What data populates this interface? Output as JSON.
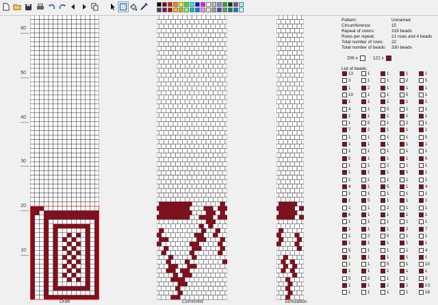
{
  "colors": {
    "filled": "#8b0b1b",
    "empty": "#ffffff",
    "line": "#333333"
  },
  "toolbar": {
    "items": [
      {
        "icon": "new-file-icon"
      },
      {
        "icon": "open-folder-icon"
      },
      {
        "icon": "save-icon"
      },
      {
        "icon": "print-icon"
      },
      {
        "icon": "undo-icon"
      },
      {
        "icon": "redo-icon"
      },
      {
        "icon": "arrow-left-icon"
      },
      {
        "icon": "arrow-right-icon"
      },
      {
        "icon": "copy-icon"
      },
      {
        "icon": "pointer-icon"
      },
      {
        "icon": "rectangle-select-icon"
      },
      {
        "icon": "fill-icon"
      },
      {
        "icon": "pipette-icon"
      }
    ],
    "palette": [
      "#000000",
      "#7f0000",
      "#ff0000",
      "#ff8000",
      "#ffff00",
      "#00ff00",
      "#00ffff",
      "#0000ff",
      "#ff00ff",
      "#ffffff",
      "#c0c0c0",
      "#8080ff",
      "#00c000",
      "#004000",
      "#8040c0",
      "#80ffff",
      "#404040",
      "#800080",
      "#c00000",
      "#ffc000",
      "#c0c000",
      "#80ff80",
      "#00c0c0",
      "#0080ff",
      "#ff80ff",
      "#e0e0e0",
      "#a0a0a0",
      "#4040c0",
      "#60a060",
      "#008080",
      "#0080c0",
      "#c0ffff"
    ]
  },
  "ruler": {
    "ticks": [
      "60",
      "50",
      "40",
      "30",
      "20",
      "10"
    ]
  },
  "panels": {
    "draft": "Draft",
    "corrected": "Corrected",
    "simulation": "Simulation"
  },
  "info": {
    "pattern_label": "Pattern:",
    "pattern_value": "Unnamed",
    "circ_label": "Circumference:",
    "circ_value": "15",
    "repeat_label": "Repeat of colors:",
    "repeat_value": "319 beads",
    "rows_repeat_label": "Rows per repeat:",
    "rows_repeat_value": "21 rows and 4 beads",
    "rows_label": "Total number of rows:",
    "rows_value": "22",
    "beads_label": "Total number of beads:",
    "beads_value": "330 beads",
    "count_white": "208 x",
    "count_red": "122 x",
    "list_title": "List of beads"
  },
  "bead_list": [
    [
      {
        "c": 1,
        "n": "13"
      },
      {
        "c": 0,
        "n": "1"
      },
      {
        "c": 1,
        "n": "1"
      },
      {
        "c": 1,
        "n": "1"
      },
      {
        "c": 1,
        "n": "1"
      }
    ],
    [
      {
        "c": 0,
        "n": "3"
      },
      {
        "c": 0,
        "n": "1"
      },
      {
        "c": 0,
        "n": "1"
      },
      {
        "c": 0,
        "n": "2"
      },
      {
        "c": 0,
        "n": "5"
      }
    ],
    [
      {
        "c": 1,
        "n": "1"
      },
      {
        "c": 1,
        "n": "2"
      },
      {
        "c": 1,
        "n": "1"
      },
      {
        "c": 1,
        "n": "1"
      },
      {
        "c": 1,
        "n": "1"
      }
    ],
    [
      {
        "c": 0,
        "n": "10"
      },
      {
        "c": 0,
        "n": "1"
      },
      {
        "c": 0,
        "n": "1"
      },
      {
        "c": 0,
        "n": "5"
      },
      {
        "c": 0,
        "n": "1"
      }
    ],
    [
      {
        "c": 1,
        "n": "1"
      },
      {
        "c": 1,
        "n": "1"
      },
      {
        "c": 1,
        "n": "1"
      },
      {
        "c": 1,
        "n": "1"
      },
      {
        "c": 1,
        "n": "1"
      }
    ],
    [
      {
        "c": 0,
        "n": "4"
      },
      {
        "c": 0,
        "n": "1"
      },
      {
        "c": 0,
        "n": "5"
      },
      {
        "c": 0,
        "n": "1"
      },
      {
        "c": 0,
        "n": "1"
      }
    ],
    [
      {
        "c": 1,
        "n": "1"
      },
      {
        "c": 1,
        "n": "1"
      },
      {
        "c": 1,
        "n": "1"
      },
      {
        "c": 1,
        "n": "1"
      },
      {
        "c": 1,
        "n": "1"
      }
    ],
    [
      {
        "c": 0,
        "n": "1"
      },
      {
        "c": 0,
        "n": "5"
      },
      {
        "c": 0,
        "n": "1"
      },
      {
        "c": 0,
        "n": "2"
      },
      {
        "c": 0,
        "n": "1"
      }
    ],
    [
      {
        "c": 1,
        "n": "7"
      },
      {
        "c": 1,
        "n": "2"
      },
      {
        "c": 1,
        "n": "1"
      },
      {
        "c": 1,
        "n": "1"
      },
      {
        "c": 1,
        "n": "1"
      }
    ],
    [
      {
        "c": 0,
        "n": "1"
      },
      {
        "c": 0,
        "n": "1"
      },
      {
        "c": 0,
        "n": "1"
      },
      {
        "c": 0,
        "n": "1"
      },
      {
        "c": 0,
        "n": "5"
      }
    ],
    [
      {
        "c": 1,
        "n": "1"
      },
      {
        "c": 1,
        "n": "1"
      },
      {
        "c": 1,
        "n": "1"
      },
      {
        "c": 1,
        "n": "1"
      },
      {
        "c": 1,
        "n": "1"
      }
    ],
    [
      {
        "c": 0,
        "n": "1"
      },
      {
        "c": 0,
        "n": "1"
      },
      {
        "c": 0,
        "n": "1"
      },
      {
        "c": 0,
        "n": "1"
      },
      {
        "c": 0,
        "n": "1"
      }
    ],
    [
      {
        "c": 1,
        "n": "5"
      },
      {
        "c": 1,
        "n": "1"
      },
      {
        "c": 1,
        "n": "1"
      },
      {
        "c": 1,
        "n": "1"
      },
      {
        "c": 1,
        "n": "6"
      }
    ],
    [
      {
        "c": 0,
        "n": "1"
      },
      {
        "c": 0,
        "n": "1"
      },
      {
        "c": 0,
        "n": "2"
      },
      {
        "c": 0,
        "n": "1"
      },
      {
        "c": 0,
        "n": "1"
      }
    ],
    [
      {
        "c": 1,
        "n": "1"
      },
      {
        "c": 1,
        "n": "1"
      },
      {
        "c": 1,
        "n": "1"
      },
      {
        "c": 1,
        "n": "5"
      },
      {
        "c": 1,
        "n": "1"
      }
    ],
    [
      {
        "c": 0,
        "n": "1"
      },
      {
        "c": 0,
        "n": "1"
      },
      {
        "c": 0,
        "n": "1"
      },
      {
        "c": 0,
        "n": "1"
      },
      {
        "c": 0,
        "n": "1"
      }
    ],
    [
      {
        "c": 1,
        "n": "4"
      },
      {
        "c": 1,
        "n": "1"
      },
      {
        "c": 1,
        "n": "5"
      },
      {
        "c": 1,
        "n": "1"
      },
      {
        "c": 1,
        "n": "4"
      }
    ],
    [
      {
        "c": 0,
        "n": "1"
      },
      {
        "c": 0,
        "n": "1"
      },
      {
        "c": 0,
        "n": "1"
      },
      {
        "c": 0,
        "n": "1"
      },
      {
        "c": 0,
        "n": "1"
      }
    ],
    [
      {
        "c": 1,
        "n": "1"
      },
      {
        "c": 1,
        "n": "5"
      },
      {
        "c": 1,
        "n": "1"
      },
      {
        "c": 1,
        "n": "1"
      },
      {
        "c": 1,
        "n": "1"
      }
    ],
    [
      {
        "c": 0,
        "n": "1"
      },
      {
        "c": 0,
        "n": "1"
      },
      {
        "c": 0,
        "n": "2"
      },
      {
        "c": 0,
        "n": "1"
      },
      {
        "c": 0,
        "n": "1"
      }
    ],
    [
      {
        "c": 1,
        "n": "6"
      },
      {
        "c": 1,
        "n": "1"
      },
      {
        "c": 1,
        "n": "1"
      },
      {
        "c": 1,
        "n": "1"
      },
      {
        "c": 1,
        "n": "1"
      }
    ],
    [
      {
        "c": 0,
        "n": "1"
      },
      {
        "c": 0,
        "n": "1"
      },
      {
        "c": 0,
        "n": "1"
      },
      {
        "c": 0,
        "n": "1"
      },
      {
        "c": 0,
        "n": "1"
      }
    ],
    [
      {
        "c": 1,
        "n": "1"
      },
      {
        "c": 1,
        "n": "1"
      },
      {
        "c": 1,
        "n": "1"
      },
      {
        "c": 1,
        "n": "2"
      },
      {
        "c": 1,
        "n": "7"
      }
    ],
    [
      {
        "c": 0,
        "n": "1"
      },
      {
        "c": 0,
        "n": "2"
      },
      {
        "c": 0,
        "n": "5"
      },
      {
        "c": 0,
        "n": "1"
      },
      {
        "c": 0,
        "n": "1"
      }
    ],
    [
      {
        "c": 1,
        "n": "1"
      },
      {
        "c": 1,
        "n": "1"
      },
      {
        "c": 1,
        "n": "1"
      },
      {
        "c": 1,
        "n": "1"
      },
      {
        "c": 1,
        "n": "1"
      }
    ],
    [
      {
        "c": 0,
        "n": "5"
      },
      {
        "c": 0,
        "n": "1"
      },
      {
        "c": 0,
        "n": "1"
      },
      {
        "c": 0,
        "n": "1"
      },
      {
        "c": 0,
        "n": "4"
      }
    ],
    [
      {
        "c": 1,
        "n": "1"
      },
      {
        "c": 1,
        "n": "1"
      },
      {
        "c": 1,
        "n": "1"
      },
      {
        "c": 1,
        "n": "1"
      },
      {
        "c": 1,
        "n": "1"
      }
    ],
    [
      {
        "c": 0,
        "n": "1"
      },
      {
        "c": 0,
        "n": "1"
      },
      {
        "c": 0,
        "n": "5"
      },
      {
        "c": 0,
        "n": "1"
      },
      {
        "c": 0,
        "n": "10"
      }
    ],
    [
      {
        "c": 1,
        "n": "1"
      },
      {
        "c": 1,
        "n": "1"
      },
      {
        "c": 1,
        "n": "1"
      },
      {
        "c": 1,
        "n": "1"
      },
      {
        "c": 1,
        "n": "1"
      }
    ],
    [
      {
        "c": 0,
        "n": "5"
      },
      {
        "c": 0,
        "n": "2"
      },
      {
        "c": 0,
        "n": "1"
      },
      {
        "c": 0,
        "n": "1"
      },
      {
        "c": 0,
        "n": "3"
      }
    ],
    [
      {
        "c": 1,
        "n": "1"
      },
      {
        "c": 1,
        "n": "1"
      },
      {
        "c": 1,
        "n": "1"
      },
      {
        "c": 1,
        "n": "1"
      },
      {
        "c": 1,
        "n": "13"
      }
    ],
    [
      {
        "c": 0,
        "n": "1"
      },
      {
        "c": 0,
        "n": "1"
      },
      {
        "c": 0,
        "n": "1"
      },
      {
        "c": 0,
        "n": "1"
      },
      {
        "c": 0,
        "n": "18"
      }
    ]
  ]
}
